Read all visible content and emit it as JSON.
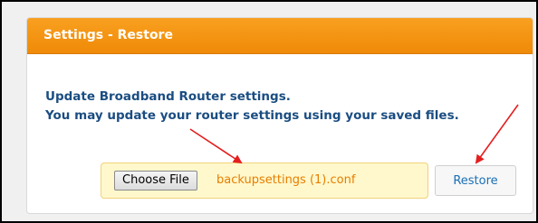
{
  "panel": {
    "title": "Settings - Restore",
    "line1": "Update Broadband Router settings.",
    "line2": "You may update your router settings using your saved files."
  },
  "file_picker": {
    "button_label": "Choose File",
    "file_name": "backupsettings (1).conf"
  },
  "restore_button": {
    "label": "Restore"
  },
  "colors": {
    "header": "#ef8a07",
    "text": "#1a4d82",
    "annotation_arrow": "#e41e1e"
  }
}
